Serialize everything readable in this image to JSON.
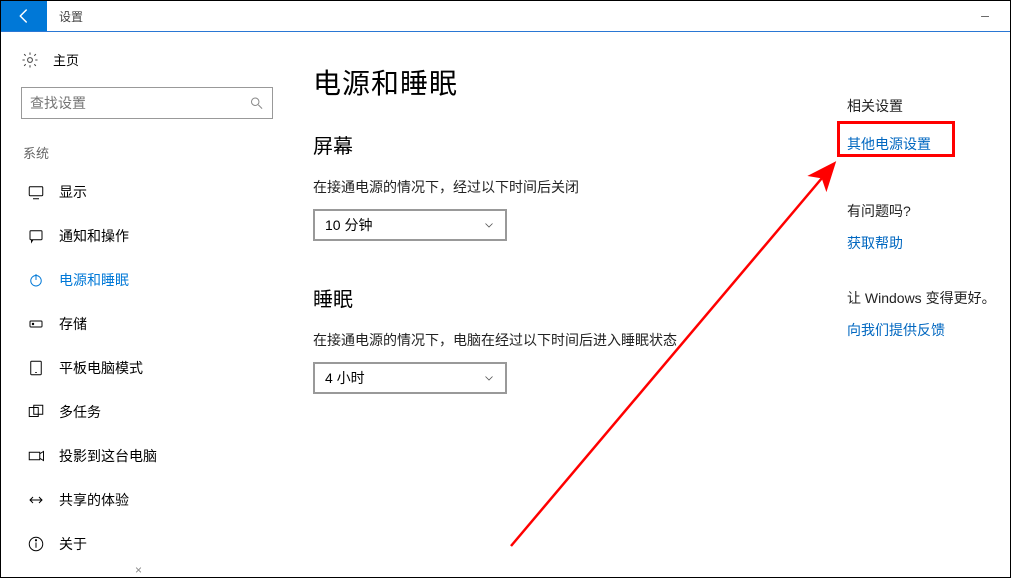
{
  "window": {
    "title": "设置",
    "minimize": "—"
  },
  "sidebar": {
    "home": "主页",
    "search_placeholder": "查找设置",
    "section": "系统",
    "items": [
      {
        "label": "显示"
      },
      {
        "label": "通知和操作"
      },
      {
        "label": "电源和睡眠"
      },
      {
        "label": "存储"
      },
      {
        "label": "平板电脑模式"
      },
      {
        "label": "多任务"
      },
      {
        "label": "投影到这台电脑"
      },
      {
        "label": "共享的体验"
      },
      {
        "label": "关于"
      }
    ]
  },
  "main": {
    "page_title": "电源和睡眠",
    "screen": {
      "title": "屏幕",
      "label": "在接通电源的情况下，经过以下时间后关闭",
      "value": "10 分钟"
    },
    "sleep": {
      "title": "睡眠",
      "label": "在接通电源的情况下，电脑在经过以下时间后进入睡眠状态",
      "value": "4 小时"
    }
  },
  "related": {
    "title": "相关设置",
    "link": "其他电源设置"
  },
  "help": {
    "title": "有问题吗?",
    "link": "获取帮助"
  },
  "feedback": {
    "title": "让 Windows 变得更好。",
    "link": "向我们提供反馈"
  },
  "tiny_close": "×",
  "colors": {
    "accent": "#0078d7",
    "annotation": "#ff0000"
  }
}
